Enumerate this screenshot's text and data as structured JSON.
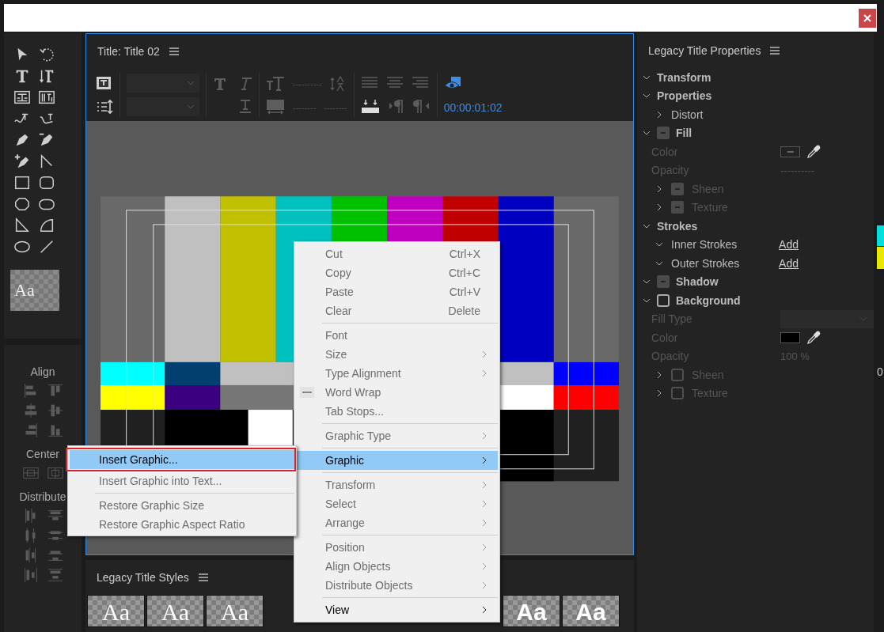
{
  "tools_panel": {
    "style_preview": "Aa"
  },
  "align_panel": {
    "align_label": "Align",
    "center_label": "Center",
    "distribute_label": "Distribute"
  },
  "title_panel": {
    "title": "Title: Title 02",
    "font_size": "----------",
    "kerning": "--------",
    "tracking": "--------",
    "timecode": "00:00:01:02"
  },
  "styles_panel": {
    "title": "Legacy Title Styles",
    "styles": [
      {
        "sample": "Aa",
        "kind": "serif"
      },
      {
        "sample": "Aa",
        "kind": "serif"
      },
      {
        "sample": "Aa",
        "kind": "serif"
      },
      {
        "sample": "Aa",
        "kind": "bold"
      },
      {
        "sample": "Aa",
        "kind": "bold"
      }
    ]
  },
  "properties_panel": {
    "title": "Legacy Title Properties",
    "sections": [
      {
        "label": "Transform",
        "expanded": true
      },
      {
        "label": "Properties",
        "expanded": true,
        "children": [
          {
            "kind": "sub",
            "label": "Distort",
            "expanded": false,
            "disabled": false
          }
        ]
      },
      {
        "label": "Fill",
        "expanded": true,
        "mixed": true,
        "children": [
          {
            "kind": "color",
            "label": "Color",
            "disabled": true,
            "mixed": true
          },
          {
            "kind": "value",
            "label": "Opacity",
            "value": "----------",
            "disabled": true
          },
          {
            "kind": "sub",
            "label": "Sheen",
            "expanded": false,
            "mixed": true,
            "disabled": true
          },
          {
            "kind": "sub",
            "label": "Texture",
            "expanded": false,
            "mixed": true,
            "disabled": true
          }
        ]
      },
      {
        "label": "Strokes",
        "expanded": true,
        "children": [
          {
            "kind": "sub",
            "label": "Inner Strokes",
            "expanded": true,
            "link": "Add",
            "disabled": false
          },
          {
            "kind": "sub",
            "label": "Outer Strokes",
            "expanded": true,
            "link": "Add",
            "disabled": false
          }
        ]
      },
      {
        "label": "Shadow",
        "expanded": true,
        "mixed": true
      },
      {
        "label": "Background",
        "expanded": true,
        "mixed": false,
        "children": [
          {
            "kind": "select",
            "label": "Fill Type",
            "disabled": true
          },
          {
            "kind": "color",
            "label": "Color",
            "disabled": true,
            "color": "#000000"
          },
          {
            "kind": "value",
            "label": "Opacity",
            "value": "100 %",
            "disabled": true
          },
          {
            "kind": "sub",
            "label": "Sheen",
            "expanded": false,
            "mixed": false,
            "disabled": true
          },
          {
            "kind": "sub",
            "label": "Texture",
            "expanded": false,
            "mixed": false,
            "disabled": true
          }
        ]
      }
    ]
  },
  "right_edge": {
    "text": "0"
  },
  "context_menu": {
    "groups": [
      [
        {
          "label": "Cut",
          "shortcut": "Ctrl+X",
          "disabled": true,
          "selected": false
        },
        {
          "label": "Copy",
          "shortcut": "Ctrl+C",
          "disabled": true,
          "selected": false
        },
        {
          "label": "Paste",
          "shortcut": "Ctrl+V",
          "disabled": true,
          "selected": false
        },
        {
          "label": "Clear",
          "shortcut": "Delete",
          "disabled": true,
          "selected": false
        }
      ],
      [
        {
          "label": "Font",
          "disabled": true,
          "selected": false
        },
        {
          "label": "Size",
          "submenu": true,
          "disabled": true,
          "selected": false
        },
        {
          "label": "Type Alignment",
          "submenu": true,
          "disabled": true,
          "selected": false
        },
        {
          "label": "Word Wrap",
          "mixed": true,
          "disabled": true,
          "selected": false
        },
        {
          "label": "Tab Stops...",
          "disabled": true,
          "selected": false
        }
      ],
      [
        {
          "label": "Graphic Type",
          "submenu": true,
          "disabled": true,
          "selected": false
        }
      ],
      [
        {
          "label": "Graphic",
          "submenu": true,
          "disabled": false,
          "selected": true
        }
      ],
      [
        {
          "label": "Transform",
          "submenu": true,
          "disabled": true,
          "selected": false
        },
        {
          "label": "Select",
          "submenu": true,
          "disabled": true,
          "selected": false
        },
        {
          "label": "Arrange",
          "submenu": true,
          "disabled": true,
          "selected": false
        }
      ],
      [
        {
          "label": "Position",
          "submenu": true,
          "disabled": true,
          "selected": false
        },
        {
          "label": "Align Objects",
          "submenu": true,
          "disabled": true,
          "selected": false
        },
        {
          "label": "Distribute Objects",
          "submenu": true,
          "disabled": true,
          "selected": false
        }
      ],
      [
        {
          "label": "View",
          "submenu": true,
          "disabled": false,
          "selected": false
        }
      ]
    ]
  },
  "submenu": {
    "groups": [
      [
        {
          "label": "Insert Graphic...",
          "disabled": false,
          "selected": true,
          "highlighted": true
        },
        {
          "label": "Insert Graphic into Text...",
          "disabled": true,
          "selected": false,
          "highlighted": false
        }
      ],
      [
        {
          "label": "Restore Graphic Size",
          "disabled": true,
          "selected": false,
          "highlighted": false
        },
        {
          "label": "Restore Graphic Aspect Ratio",
          "disabled": true,
          "selected": false,
          "highlighted": false
        }
      ]
    ]
  }
}
